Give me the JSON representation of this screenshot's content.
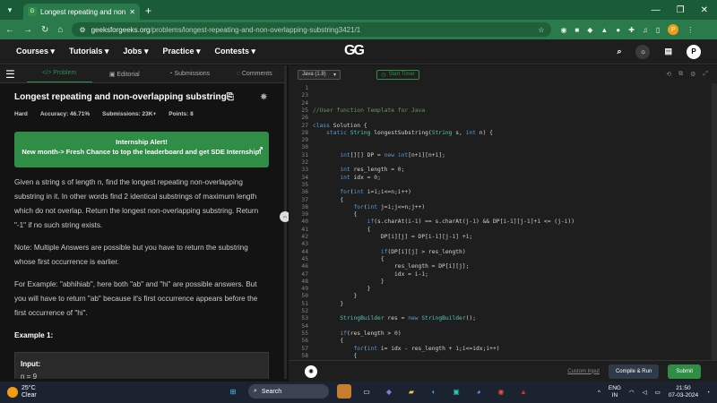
{
  "browser": {
    "tab_title": "Longest repeating and non-ov",
    "url_host": "geeksforgeeks.org",
    "url_path": "/problems/longest-repeating-and-non-overlapping-substring3421/1",
    "profile_initial": "P"
  },
  "nav": {
    "items": [
      "Courses",
      "Tutorials",
      "Jobs",
      "Practice",
      "Contests"
    ],
    "logo": "GG",
    "profile_initial": "P"
  },
  "left_tabs": [
    "Problem",
    "Editorial",
    "Submissions",
    "Comments"
  ],
  "problem": {
    "title": "Longest repeating and non-overlapping substring",
    "difficulty": "Hard",
    "accuracy": "Accuracy: 46.71%",
    "submissions": "Submissions: 23K+",
    "points": "Points: 8",
    "alert_line1": "Internship Alert!",
    "alert_line2": "New month-> Fresh Chance to top the leaderboard and get SDE Internship!",
    "desc_p1": "Given a string s of length n, find the longest repeating non-overlapping substring in it. In other words find 2 identical substrings of maximum length which do not overlap. Return the longest non-overlapping substring. Return \"-1\" if no such string exists.",
    "note": "Note: Multiple Answers are possible but you have to return the substring whose first occurrence is earlier.",
    "example": "For Example: \"abhihiab\", here both \"ab\" and \"hi\" are possible answers. But you will have to return \"ab\" because it's first occurrence appears before the first occurrence of \"hi\".",
    "example1_heading": "Example 1:",
    "input_label": "Input:",
    "input_value": "n = 9"
  },
  "editor": {
    "language": "Java (1.8)",
    "timer": "Start Timer",
    "lines": [
      {
        "n": "1",
        "t": ""
      },
      {
        "n": "23",
        "t": ""
      },
      {
        "n": "24",
        "t": ""
      },
      {
        "n": "25",
        "t": "//User function Template for Java"
      },
      {
        "n": "26",
        "t": ""
      },
      {
        "n": "27",
        "t": "class Solution {"
      },
      {
        "n": "28",
        "t": "    static String longestSubstring(String s, int n) {"
      },
      {
        "n": "29",
        "t": ""
      },
      {
        "n": "30",
        "t": ""
      },
      {
        "n": "31",
        "t": "        int[][] DP = new int[n+1][n+1];"
      },
      {
        "n": "32",
        "t": ""
      },
      {
        "n": "33",
        "t": "        int res_length = 0;"
      },
      {
        "n": "34",
        "t": "        int idx = 0;"
      },
      {
        "n": "35",
        "t": ""
      },
      {
        "n": "36",
        "t": "        for(int i=1;i<=n;i++)"
      },
      {
        "n": "37",
        "t": "        {"
      },
      {
        "n": "38",
        "t": "            for(int j=i;j<=n;j++)"
      },
      {
        "n": "39",
        "t": "            {"
      },
      {
        "n": "40",
        "t": "                if(s.charAt(i-1) == s.charAt(j-1) && DP[i-1][j-1]+1 <= (j-i))"
      },
      {
        "n": "41",
        "t": "                {"
      },
      {
        "n": "42",
        "t": "                    DP[i][j] = DP[i-1][j-1] +1;"
      },
      {
        "n": "43",
        "t": ""
      },
      {
        "n": "44",
        "t": "                    if(DP[i][j] > res_length)"
      },
      {
        "n": "45",
        "t": "                    {"
      },
      {
        "n": "46",
        "t": "                        res_length = DP[i][j];"
      },
      {
        "n": "47",
        "t": "                        idx = i-1;"
      },
      {
        "n": "48",
        "t": "                    }"
      },
      {
        "n": "49",
        "t": "                }"
      },
      {
        "n": "50",
        "t": "            }"
      },
      {
        "n": "51",
        "t": "        }"
      },
      {
        "n": "52",
        "t": ""
      },
      {
        "n": "53",
        "t": "        StringBuilder res = new StringBuilder();"
      },
      {
        "n": "54",
        "t": ""
      },
      {
        "n": "55",
        "t": "        if(res_length > 0)"
      },
      {
        "n": "56",
        "t": "        {"
      },
      {
        "n": "57",
        "t": "            for(int i= idx - res_length + 1;i<=idx;i++)"
      },
      {
        "n": "58",
        "t": "            {"
      }
    ]
  },
  "bottom": {
    "custom_input": "Custom Input",
    "compile": "Compile & Run",
    "submit": "Submit"
  },
  "taskbar": {
    "temp": "25°C",
    "weather": "Clear",
    "search": "Search",
    "lang": "ENG",
    "region": "IN",
    "time": "21:50",
    "date": "07-03-2024"
  },
  "colors": {
    "accent": "#2f8d46",
    "browser_frame": "#2b7a4c"
  }
}
